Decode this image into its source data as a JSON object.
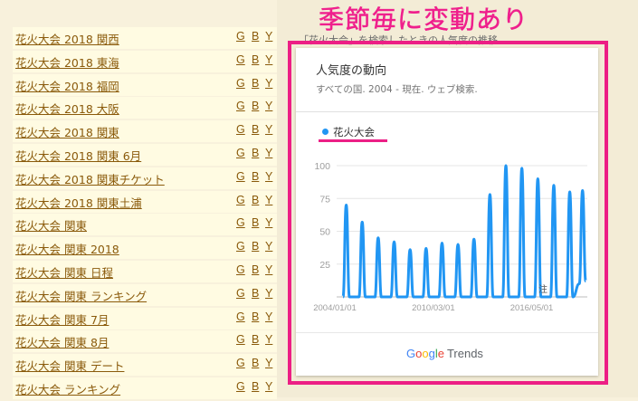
{
  "keywords": [
    {
      "label": "花火大会 2018 関西"
    },
    {
      "label": "花火大会 2018 東海"
    },
    {
      "label": "花火大会 2018 福岡"
    },
    {
      "label": "花火大会 2018 大阪"
    },
    {
      "label": "花火大会 2018 関東"
    },
    {
      "label": "花火大会 2018 関東 6月"
    },
    {
      "label": "花火大会 2018 関東チケット"
    },
    {
      "label": "花火大会 2018 関東土浦"
    },
    {
      "label": "花火大会 関東"
    },
    {
      "label": "花火大会 関東 2018"
    },
    {
      "label": "花火大会 関東 日程"
    },
    {
      "label": "花火大会 関東 ランキング"
    },
    {
      "label": "花火大会 関東 7月"
    },
    {
      "label": "花火大会 関東 8月"
    },
    {
      "label": "花火大会 関東 デート"
    },
    {
      "label": "花火大会 ランキング"
    }
  ],
  "engine_links": {
    "g": "G",
    "b": "B",
    "y": "Y"
  },
  "overlay_title": "季節毎に変動あり",
  "hidden_text": "「花火大会」を検索したときの人気度の推移",
  "trends_card": {
    "title": "人気度の動向",
    "subtitle": "すべての国. 2004 - 現在. ウェブ検索.",
    "legend": "花火大会",
    "logo_google": [
      "G",
      "o",
      "o",
      "g",
      "l",
      "e"
    ],
    "logo_trends": "Trends"
  },
  "colors": {
    "series": "#2196f3",
    "highlight": "#ec1f85",
    "link": "#8a5a0b"
  },
  "chart_data": {
    "type": "line",
    "series": [
      {
        "name": "花火大会",
        "values": [
          {
            "x": 2004.4,
            "y": 0
          },
          {
            "x": 2004.6,
            "y": 70
          },
          {
            "x": 2004.8,
            "y": 0
          },
          {
            "x": 2005.4,
            "y": 0
          },
          {
            "x": 2005.6,
            "y": 57
          },
          {
            "x": 2005.8,
            "y": 0
          },
          {
            "x": 2006.4,
            "y": 0
          },
          {
            "x": 2006.6,
            "y": 45
          },
          {
            "x": 2006.8,
            "y": 0
          },
          {
            "x": 2007.4,
            "y": 0
          },
          {
            "x": 2007.6,
            "y": 42
          },
          {
            "x": 2007.8,
            "y": 0
          },
          {
            "x": 2008.4,
            "y": 0
          },
          {
            "x": 2008.6,
            "y": 36
          },
          {
            "x": 2008.8,
            "y": 0
          },
          {
            "x": 2009.4,
            "y": 0
          },
          {
            "x": 2009.6,
            "y": 37
          },
          {
            "x": 2009.8,
            "y": 0
          },
          {
            "x": 2010.4,
            "y": 0
          },
          {
            "x": 2010.6,
            "y": 41
          },
          {
            "x": 2010.8,
            "y": 0
          },
          {
            "x": 2011.4,
            "y": 0
          },
          {
            "x": 2011.6,
            "y": 40
          },
          {
            "x": 2011.8,
            "y": 0
          },
          {
            "x": 2012.4,
            "y": 0
          },
          {
            "x": 2012.6,
            "y": 44
          },
          {
            "x": 2012.8,
            "y": 0
          },
          {
            "x": 2013.4,
            "y": 0
          },
          {
            "x": 2013.6,
            "y": 78
          },
          {
            "x": 2013.8,
            "y": 0
          },
          {
            "x": 2014.4,
            "y": 0
          },
          {
            "x": 2014.6,
            "y": 100
          },
          {
            "x": 2014.8,
            "y": 0
          },
          {
            "x": 2015.4,
            "y": 0
          },
          {
            "x": 2015.6,
            "y": 98
          },
          {
            "x": 2015.8,
            "y": 0
          },
          {
            "x": 2016.4,
            "y": 0
          },
          {
            "x": 2016.6,
            "y": 90
          },
          {
            "x": 2016.8,
            "y": 0
          },
          {
            "x": 2017.4,
            "y": 0
          },
          {
            "x": 2017.6,
            "y": 85
          },
          {
            "x": 2017.8,
            "y": 0
          },
          {
            "x": 2018.4,
            "y": 0
          },
          {
            "x": 2018.6,
            "y": 80
          },
          {
            "x": 2018.8,
            "y": 0
          },
          {
            "x": 2019.2,
            "y": 10
          },
          {
            "x": 2019.4,
            "y": 81
          },
          {
            "x": 2019.6,
            "y": 12
          }
        ]
      }
    ],
    "x_ticks": [
      "2004/01/01",
      "2010/03/01",
      "2016/05/01"
    ],
    "y_ticks": [
      25,
      50,
      75,
      100
    ],
    "ylim": [
      0,
      100
    ],
    "annotation": "注"
  }
}
